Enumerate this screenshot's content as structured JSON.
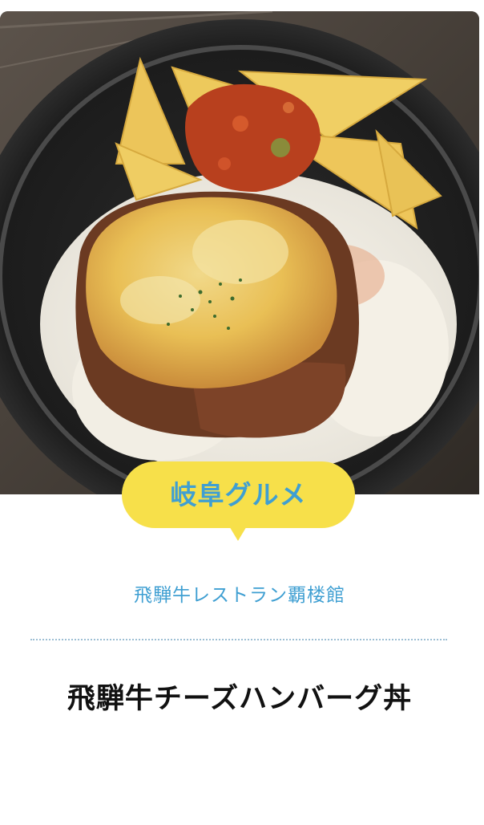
{
  "card": {
    "photo_alt": "",
    "category": "岐阜グルメ",
    "restaurant": "飛騨牛レストラン覇楼館",
    "dish": "飛騨牛チーズハンバーグ丼"
  },
  "colors": {
    "badge_bg": "#f7e04a",
    "accent_blue": "#3f9fd2",
    "title_text": "#111111"
  },
  "icons": {
    "badge_tail": "speech-bubble-tail"
  }
}
